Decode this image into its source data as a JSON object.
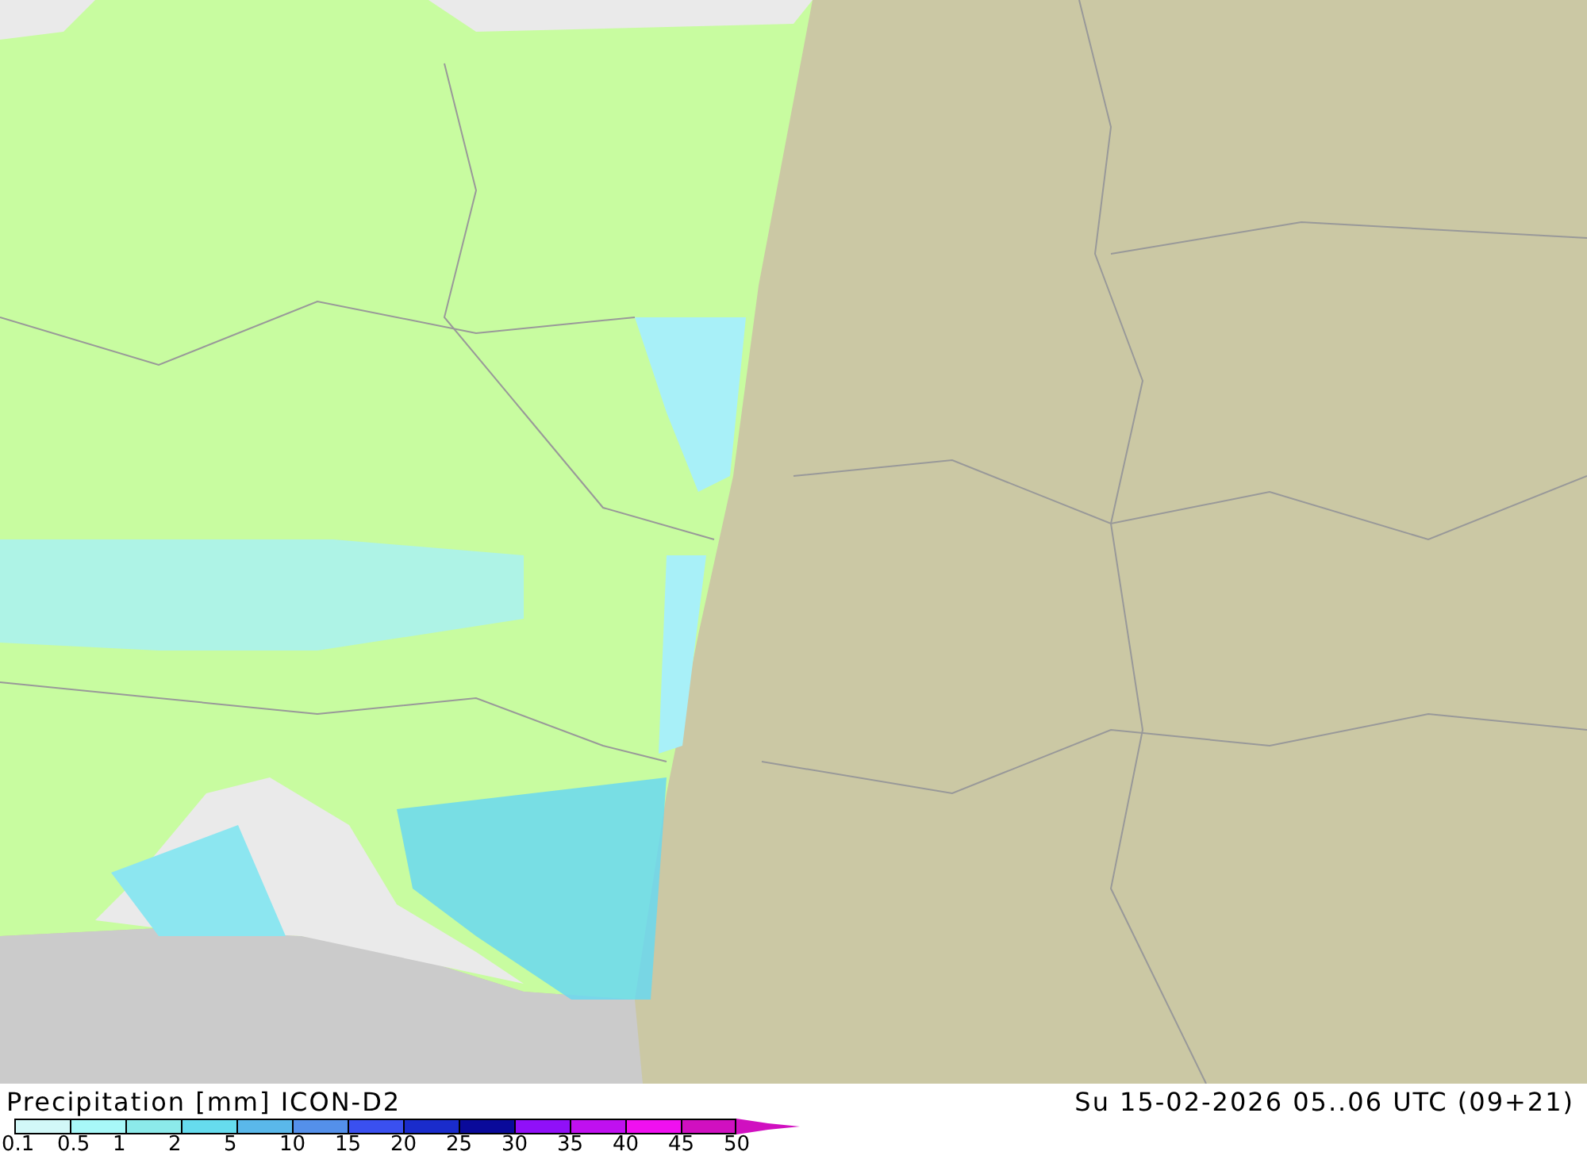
{
  "map": {
    "title": "Precipitation [mm] ICON-D2",
    "valid_time": "Su 15-02-2026 05..06 UTC (09+21)"
  },
  "legend": {
    "swatches": [
      {
        "color": "#d2f8f8"
      },
      {
        "color": "#a8f8f8"
      },
      {
        "color": "#8ceaea"
      },
      {
        "color": "#66dcee"
      },
      {
        "color": "#5ab8ea"
      },
      {
        "color": "#5490ea"
      },
      {
        "color": "#3a50f0"
      },
      {
        "color": "#1a2ccc"
      },
      {
        "color": "#0a0a9a"
      },
      {
        "color": "#9010f8"
      },
      {
        "color": "#c010f0"
      },
      {
        "color": "#f010f0"
      },
      {
        "color": "#d010c0"
      }
    ],
    "ticks": [
      "0.1",
      "0.5",
      "1",
      "2",
      "5",
      "10",
      "15",
      "20",
      "25",
      "30",
      "35",
      "40",
      "45",
      "50"
    ]
  }
}
